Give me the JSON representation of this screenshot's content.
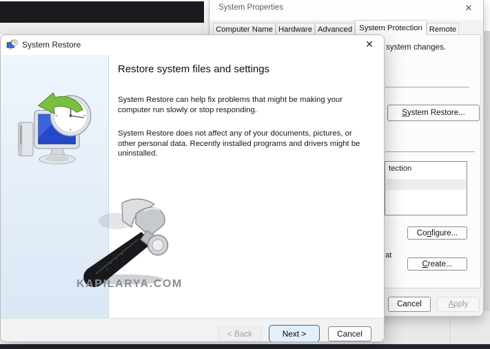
{
  "system_properties": {
    "title": "System Properties",
    "close_icon": "✕",
    "tabs": [
      {
        "label": "Computer Name"
      },
      {
        "label": "Hardware"
      },
      {
        "label": "Advanced"
      },
      {
        "label": "System Protection"
      },
      {
        "label": "Remote"
      }
    ],
    "protection_tab": {
      "undo_fragment": "system changes.",
      "system_restore_button": {
        "pre": "",
        "accel": "S",
        "post": "ystem Restore..."
      },
      "drives_list": {
        "header_fragment": "tection"
      },
      "configure_button": {
        "pre": "Co",
        "accel": "n",
        "post": "figure..."
      },
      "create_hint_fragment": "at",
      "create_button": {
        "pre": "",
        "accel": "C",
        "post": "reate..."
      }
    },
    "footer": {
      "cancel_button": "Cancel",
      "apply_button": {
        "pre": "",
        "accel": "A",
        "post": "pply"
      }
    }
  },
  "system_restore_wizard": {
    "title": "System Restore",
    "close_icon": "✕",
    "heading": "Restore system files and settings",
    "paragraph1_lines": [
      "System Restore can help fix problems that might be making your",
      "computer run slowly or stop responding."
    ],
    "paragraph2_lines": [
      "System Restore does not affect any of your documents, pictures, or",
      "other personal data. Recently installed programs and drivers might be",
      "uninstalled."
    ],
    "buttons": {
      "back": "< Back",
      "next": "Next >",
      "cancel": "Cancel"
    }
  },
  "watermark": {
    "text": "KAPILARYA.COM"
  },
  "colors": {
    "accent_blue": "#1c6db5",
    "next_button_fill": "#e3f0fa",
    "left_panel_top": "#eff5fc",
    "left_panel_bottom": "#dae7f5",
    "selection_gray": "#ededed"
  }
}
